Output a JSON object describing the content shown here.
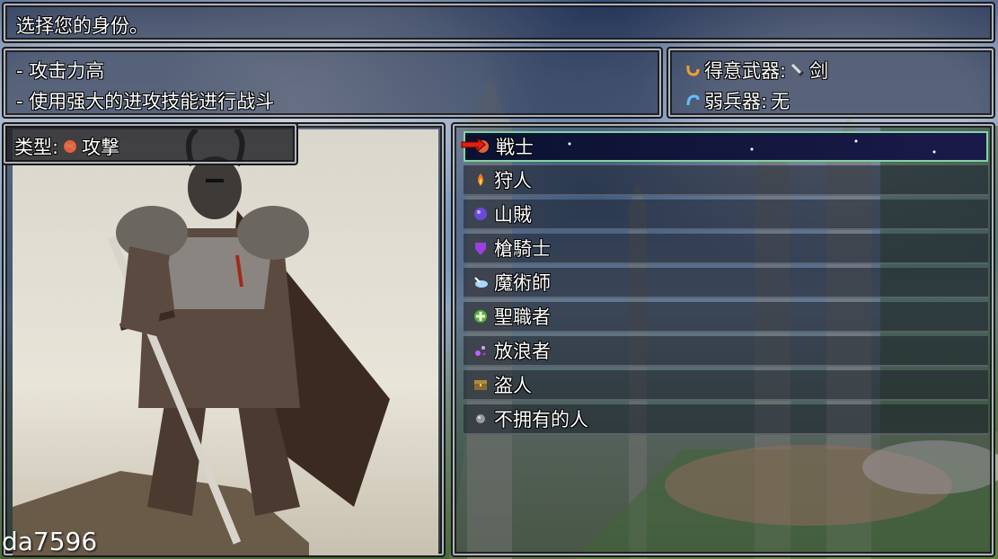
{
  "help_text": "选择您的身份。",
  "description": {
    "line1": "- 攻击力高",
    "line2": "- 使用强大的进攻技能进行战斗"
  },
  "weapons": {
    "favored_label": "得意武器:",
    "favored_value": "剑",
    "weak_label": "弱兵器:",
    "weak_value": "无"
  },
  "type_box": {
    "label": "类型:",
    "value": "攻撃"
  },
  "class_list": [
    {
      "label": "戦士",
      "icon": "fist-icon",
      "selected": true
    },
    {
      "label": "狩人",
      "icon": "flame-icon"
    },
    {
      "label": "山賊",
      "icon": "purple-orb-icon"
    },
    {
      "label": "槍騎士",
      "icon": "purple-shield-icon"
    },
    {
      "label": "魔術師",
      "icon": "magic-cloud-icon"
    },
    {
      "label": "聖職者",
      "icon": "green-cross-icon"
    },
    {
      "label": "放浪者",
      "icon": "purple-sparkle-icon"
    },
    {
      "label": "盗人",
      "icon": "treasure-chest-icon"
    },
    {
      "label": "不拥有的人",
      "icon": "gray-orb-icon"
    }
  ],
  "watermark": "da7596",
  "colors": {
    "selected_border": "#7fd6a0",
    "window_border": "#c8cdd7"
  }
}
